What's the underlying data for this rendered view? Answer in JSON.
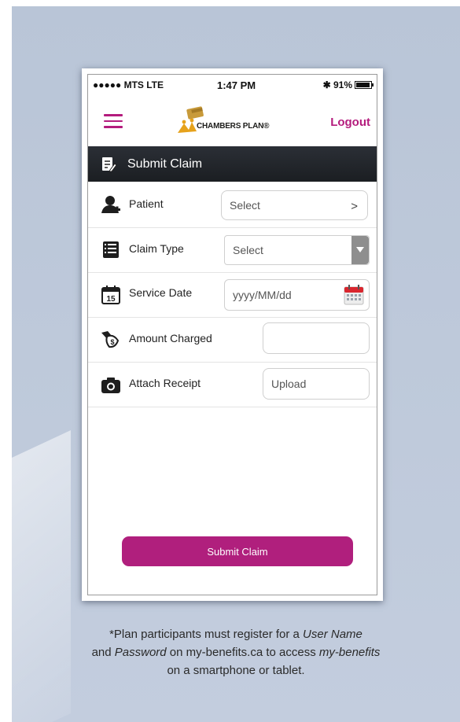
{
  "status_bar": {
    "carrier": "●●●●● MTS  LTE",
    "time": "1:47 PM",
    "battery": "✱ 91%"
  },
  "navbar": {
    "brand": "CHAMBERS PLAN®",
    "logout_label": "Logout",
    "accent_color": "#b41c7d"
  },
  "header": {
    "title": "Submit Claim"
  },
  "form": {
    "patient": {
      "label": "Patient",
      "value": "Select"
    },
    "claim_type": {
      "label": "Claim Type",
      "value": "Select"
    },
    "service_date": {
      "label": "Service Date",
      "placeholder": "yyyy/MM/dd",
      "calendar_day": "15"
    },
    "amount_charged": {
      "label": "Amount Charged",
      "value": ""
    },
    "attach_receipt": {
      "label": "Attach Receipt",
      "value": "Upload"
    }
  },
  "submit_label": "Submit Claim",
  "footnote": {
    "l1a": "*Plan participants must register for a ",
    "l1b": "User Name",
    "l2a": "and ",
    "l2b": "Password",
    "l2c": " on my-benefits.ca to access ",
    "l2d": "my-benefits",
    "l3": "on a smartphone or tablet."
  },
  "icons": [
    "menu-icon",
    "chambers-plan-logo",
    "document-edit-icon",
    "patient-icon",
    "claim-type-icon",
    "calendar-icon",
    "calendar-picker-icon",
    "money-icon",
    "camera-icon",
    "chevron-right-icon",
    "dropdown-arrow-icon"
  ]
}
